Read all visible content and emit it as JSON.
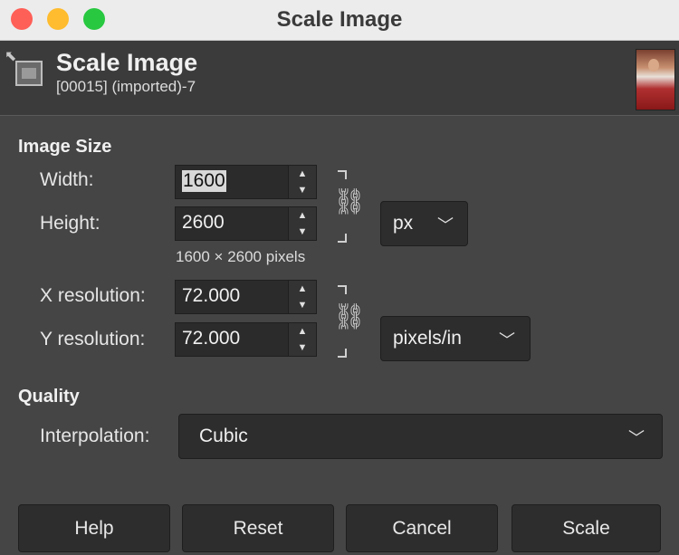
{
  "window": {
    "title": "Scale Image"
  },
  "header": {
    "title": "Scale Image",
    "subtitle": "[00015] (imported)-7"
  },
  "image_size": {
    "section_title": "Image Size",
    "width_label": "Width:",
    "width_value": "1600",
    "height_label": "Height:",
    "height_value": "2600",
    "unit": "px",
    "pixel_info": "1600 × 2600 pixels",
    "x_res_label": "X resolution:",
    "x_res_value": "72.000",
    "y_res_label": "Y resolution:",
    "y_res_value": "72.000",
    "res_unit": "pixels/in"
  },
  "quality": {
    "section_title": "Quality",
    "interpolation_label": "Interpolation:",
    "interpolation_value": "Cubic"
  },
  "buttons": {
    "help": "Help",
    "reset": "Reset",
    "cancel": "Cancel",
    "scale": "Scale"
  },
  "colors": {
    "background": "#454545",
    "titlebar": "#ececec",
    "close": "#fe5f57",
    "minimize": "#febc2e",
    "maximize": "#28c840"
  }
}
